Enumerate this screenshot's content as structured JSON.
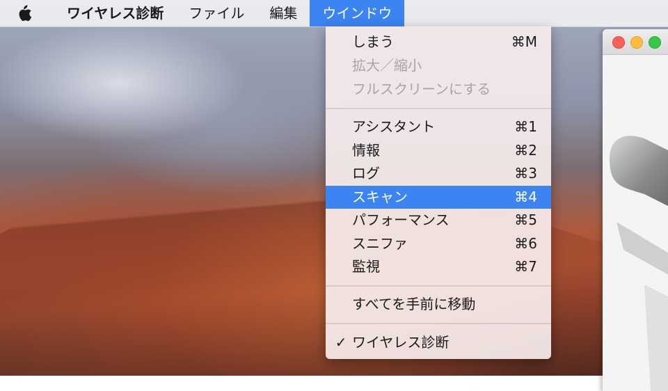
{
  "menubar": {
    "apple_icon": "apple-logo-icon",
    "app_name": "ワイヤレス診断",
    "items": [
      "ファイル",
      "編集",
      "ウインドウ"
    ]
  },
  "window_menu": {
    "items": [
      {
        "label": "しまう",
        "shortcut": "⌘M",
        "state": "enabled"
      },
      {
        "label": "拡大／縮小",
        "shortcut": "",
        "state": "disabled"
      },
      {
        "label": "フルスクリーンにする",
        "shortcut": "",
        "state": "disabled"
      },
      {
        "label": "アシスタント",
        "shortcut": "⌘1",
        "state": "enabled"
      },
      {
        "label": "情報",
        "shortcut": "⌘2",
        "state": "enabled"
      },
      {
        "label": "ログ",
        "shortcut": "⌘3",
        "state": "enabled"
      },
      {
        "label": "スキャン",
        "shortcut": "⌘4",
        "state": "highlighted"
      },
      {
        "label": "パフォーマンス",
        "shortcut": "⌘5",
        "state": "enabled"
      },
      {
        "label": "スニファ",
        "shortcut": "⌘6",
        "state": "enabled"
      },
      {
        "label": "監視",
        "shortcut": "⌘7",
        "state": "enabled"
      },
      {
        "label": "すべてを手前に移動",
        "shortcut": "",
        "state": "enabled"
      },
      {
        "label": "ワイヤレス診断",
        "shortcut": "",
        "state": "checked",
        "check": "✓"
      }
    ]
  },
  "colors": {
    "highlight": "#3b84f2",
    "close": "#fc605c",
    "minimize": "#fdbc40",
    "zoom": "#34c84a"
  }
}
